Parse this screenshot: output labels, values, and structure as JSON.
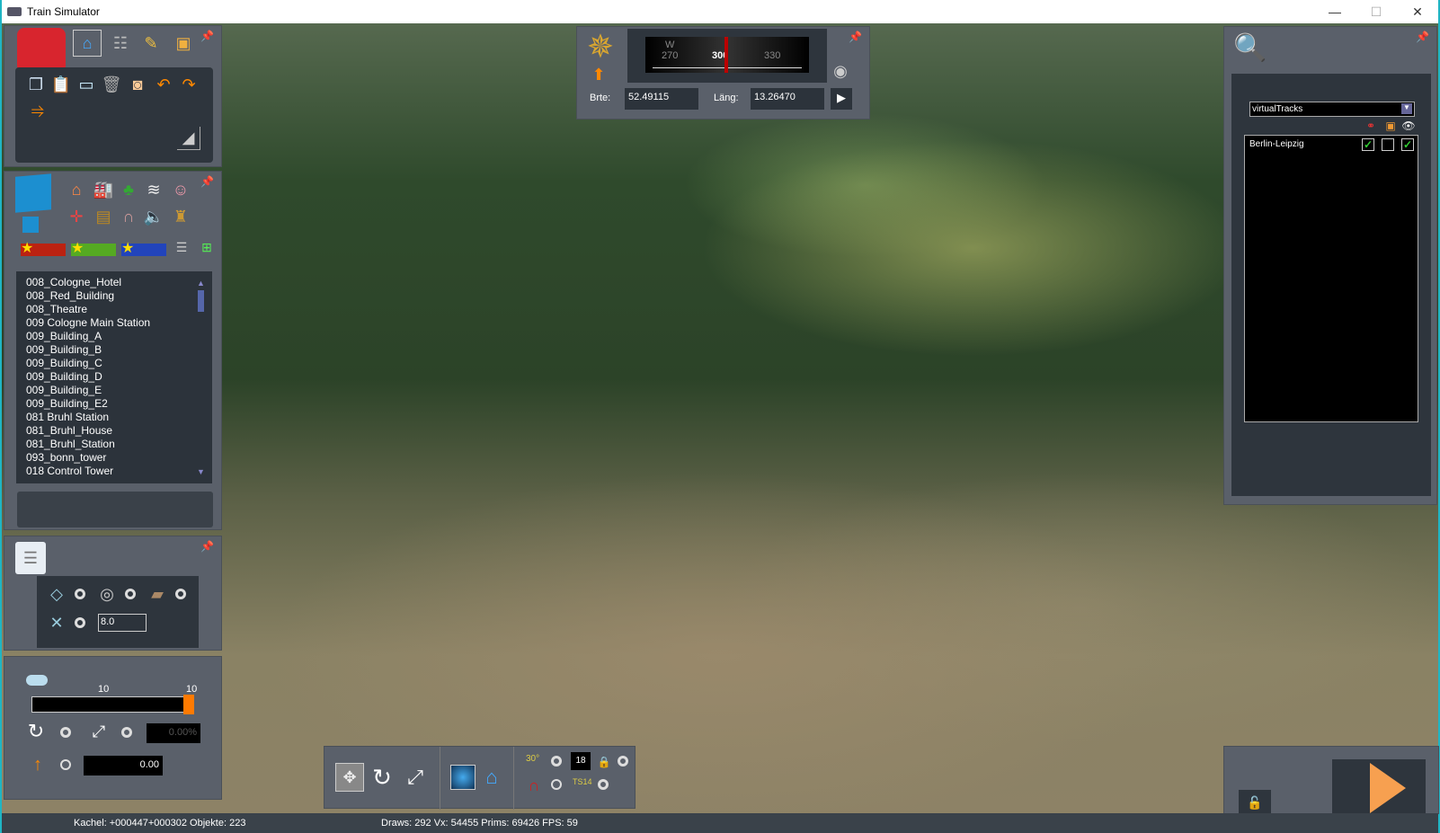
{
  "window": {
    "title": "Train Simulator",
    "minimize": "—",
    "maximize": "☐",
    "close": "✕"
  },
  "toolbox": {
    "tabs": [
      "home",
      "tracks",
      "paint",
      "train"
    ],
    "tools": [
      "copy",
      "paste",
      "screen",
      "delete",
      "measure",
      "undo",
      "redo",
      "flatten"
    ]
  },
  "objects": {
    "categories": [
      "house",
      "industry",
      "tree",
      "landscape",
      "person",
      "signal",
      "bench",
      "bridge",
      "sound",
      "bag"
    ],
    "list": [
      "008_Cologne_Hotel",
      "008_Red_Building",
      "008_Theatre",
      "009 Cologne Main Station",
      "009_Building_A",
      "009_Building_B",
      "009_Building_C",
      "009_Building_D",
      "009_Building_E",
      "009_Building_E2",
      "081 Bruhl Station",
      "081_Bruhl_House",
      "081_Bruhl_Station",
      "093_bonn_tower",
      "018 Control Tower"
    ],
    "scroll_up": "▲",
    "scroll_down": "▼"
  },
  "terrain": {
    "value": "8.0"
  },
  "slider": {
    "label_left": "10",
    "label_right": "10",
    "percent": "0.00%",
    "height": "0.00",
    "level": 1.0
  },
  "compass": {
    "heading_labels": [
      "W",
      "270",
      "300",
      "330"
    ],
    "heading": 300,
    "lat_label": "Brte:",
    "lat": "52.49115",
    "lon_label": "Läng:",
    "lon": "13.26470",
    "go": "▶"
  },
  "tracks": {
    "dropdown": "virtualTracks",
    "rows": [
      {
        "name": "Berlin-Leipzig",
        "c1": true,
        "c2": false,
        "c3": true
      }
    ]
  },
  "bottombar": {
    "angle": "30°",
    "num": "18",
    "ts": "TS14"
  },
  "status": {
    "left": "Kachel: +000447+000302  Objekte: 223",
    "right": "Draws: 292 Vx: 54455 Prims: 69426 FPS: 59"
  },
  "colors": {
    "accent": "#ff7a00",
    "play": "#f7a050",
    "border": "#1fb5c4"
  }
}
